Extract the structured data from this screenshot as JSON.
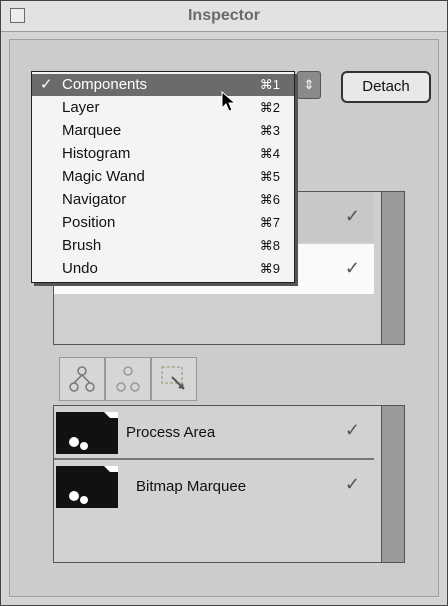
{
  "window": {
    "title": "Inspector"
  },
  "detach_label": "Detach",
  "menu": {
    "items": [
      {
        "label": "Components",
        "shortcut": "⌘1",
        "checked": true,
        "selected": true
      },
      {
        "label": "Layer",
        "shortcut": "⌘2"
      },
      {
        "label": "Marquee",
        "shortcut": "⌘3"
      },
      {
        "label": "Histogram",
        "shortcut": "⌘4"
      },
      {
        "label": "Magic Wand",
        "shortcut": "⌘5"
      },
      {
        "label": "Navigator",
        "shortcut": "⌘6"
      },
      {
        "label": "Position",
        "shortcut": "⌘7"
      },
      {
        "label": "Brush",
        "shortcut": "⌘8"
      },
      {
        "label": "Undo",
        "shortcut": "⌘9"
      }
    ]
  },
  "top_list": {
    "rows": [
      {
        "checked": true
      },
      {
        "checked": true
      }
    ]
  },
  "tools": [
    "hierarchy-icon",
    "group-icon",
    "marquee-select-icon"
  ],
  "bottom_list": {
    "rows": [
      {
        "label": "Process Area",
        "checked": true
      },
      {
        "label": "Bitmap Marquee",
        "checked": true
      }
    ]
  }
}
